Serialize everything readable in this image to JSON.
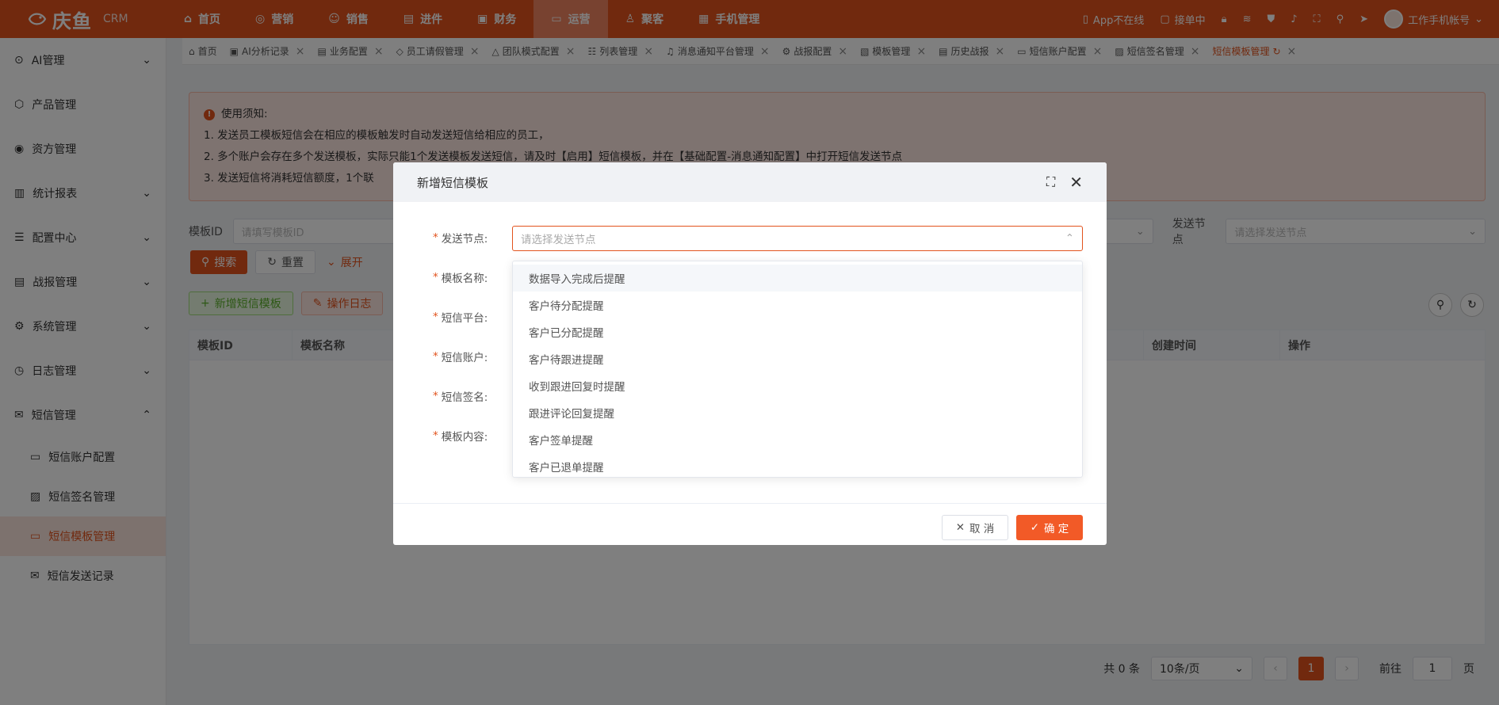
{
  "app": {
    "logo": "庆鱼",
    "sub": "CRM"
  },
  "topnav": [
    {
      "label": "首页",
      "icon": "home-icon",
      "active": false
    },
    {
      "label": "营销",
      "icon": "target-icon",
      "active": false
    },
    {
      "label": "销售",
      "icon": "people-icon",
      "active": false
    },
    {
      "label": "进件",
      "icon": "document-icon",
      "active": false
    },
    {
      "label": "财务",
      "icon": "finance-icon",
      "active": false
    },
    {
      "label": "运营",
      "icon": "monitor-icon",
      "active": true
    },
    {
      "label": "聚客",
      "icon": "user-icon",
      "active": false
    },
    {
      "label": "手机管理",
      "icon": "phone-manage-icon",
      "active": false
    }
  ],
  "topright": {
    "app_status": "App不在线",
    "order_status": "接单中",
    "account": "工作手机帐号"
  },
  "sidebar": {
    "items": [
      {
        "label": "AI管理",
        "icon": "ai-icon",
        "arrow": true
      },
      {
        "label": "产品管理",
        "icon": "cube-icon",
        "arrow": false
      },
      {
        "label": "资方管理",
        "icon": "funder-icon",
        "arrow": false
      },
      {
        "label": "统计报表",
        "icon": "chart-icon",
        "arrow": true
      },
      {
        "label": "配置中心",
        "icon": "config-icon",
        "arrow": true
      },
      {
        "label": "战报管理",
        "icon": "report-icon",
        "arrow": true
      },
      {
        "label": "系统管理",
        "icon": "system-icon",
        "arrow": true
      },
      {
        "label": "日志管理",
        "icon": "log-icon",
        "arrow": true
      },
      {
        "label": "短信管理",
        "icon": "sms-icon",
        "arrow": true,
        "expanded": true
      }
    ],
    "subitems": [
      {
        "label": "短信账户配置",
        "icon": "account-icon",
        "active": false
      },
      {
        "label": "短信签名管理",
        "icon": "signature-icon",
        "active": false
      },
      {
        "label": "短信模板管理",
        "icon": "template-icon",
        "active": true
      },
      {
        "label": "短信发送记录",
        "icon": "mail-icon",
        "active": false
      }
    ]
  },
  "tabs": [
    {
      "label": "首页",
      "icon": "home-icon",
      "closable": false
    },
    {
      "label": "AI分析记录",
      "icon": "ai-icon",
      "closable": true
    },
    {
      "label": "业务配置",
      "icon": "config-icon",
      "closable": true
    },
    {
      "label": "员工请假管理",
      "icon": "leave-icon",
      "closable": true
    },
    {
      "label": "团队模式配置",
      "icon": "team-icon",
      "closable": true
    },
    {
      "label": "列表管理",
      "icon": "list-icon",
      "closable": true
    },
    {
      "label": "消息通知平台管理",
      "icon": "bell-icon",
      "closable": true
    },
    {
      "label": "战报配置",
      "icon": "gear-icon",
      "closable": true
    },
    {
      "label": "模板管理",
      "icon": "template-icon",
      "closable": true
    },
    {
      "label": "历史战报",
      "icon": "history-icon",
      "closable": true
    },
    {
      "label": "短信账户配置",
      "icon": "account-icon",
      "closable": true
    },
    {
      "label": "短信签名管理",
      "icon": "signature-icon",
      "closable": true
    },
    {
      "label": "短信模板管理",
      "icon": "refresh-icon",
      "closable": true,
      "active": true
    }
  ],
  "notice": {
    "title": "使用须知:",
    "lines": [
      "1. 发送员工模板短信会在相应的模板触发时自动发送短信给相应的员工，",
      "2. 多个账户会存在多个发送模板，实际只能1个发送模板发送短信，请及时【启用】短信模板，并在【基础配置-消息通知配置】中打开短信发送节点",
      "3. 发送短信将消耗短信额度，1个联"
    ]
  },
  "filter": {
    "template_id_label": "模板ID",
    "template_id_placeholder": "请填写模板ID",
    "search": "搜索",
    "reset": "重置",
    "expand": "展开",
    "node_label": "发送节点",
    "node_placeholder": "请选择发送节点"
  },
  "actions": {
    "add": "新增短信模板",
    "log": "操作日志"
  },
  "table": {
    "columns": [
      "模板ID",
      "模板名称",
      "创建时间",
      "操作"
    ]
  },
  "pager": {
    "total": "共 0 条",
    "page_size": "10条/页",
    "current": "1",
    "goto_label": "前往",
    "goto_value": "1",
    "page_unit": "页"
  },
  "modal": {
    "title": "新增短信模板",
    "fields": [
      "发送节点:",
      "模板名称:",
      "短信平台:",
      "短信账户:",
      "短信签名:",
      "模板内容:"
    ],
    "select_placeholder": "请选择发送节点",
    "options": [
      "数据导入完成后提醒",
      "客户待分配提醒",
      "客户已分配提醒",
      "客户待跟进提醒",
      "收到跟进回复时提醒",
      "跟进评论回复提醒",
      "客户签单提醒",
      "客户已退单提醒"
    ],
    "cancel": "取 消",
    "confirm": "确 定"
  },
  "colors": {
    "brand": "#e2531d",
    "active_nav": "#f08560",
    "notice_bg": "#fde6e0"
  }
}
